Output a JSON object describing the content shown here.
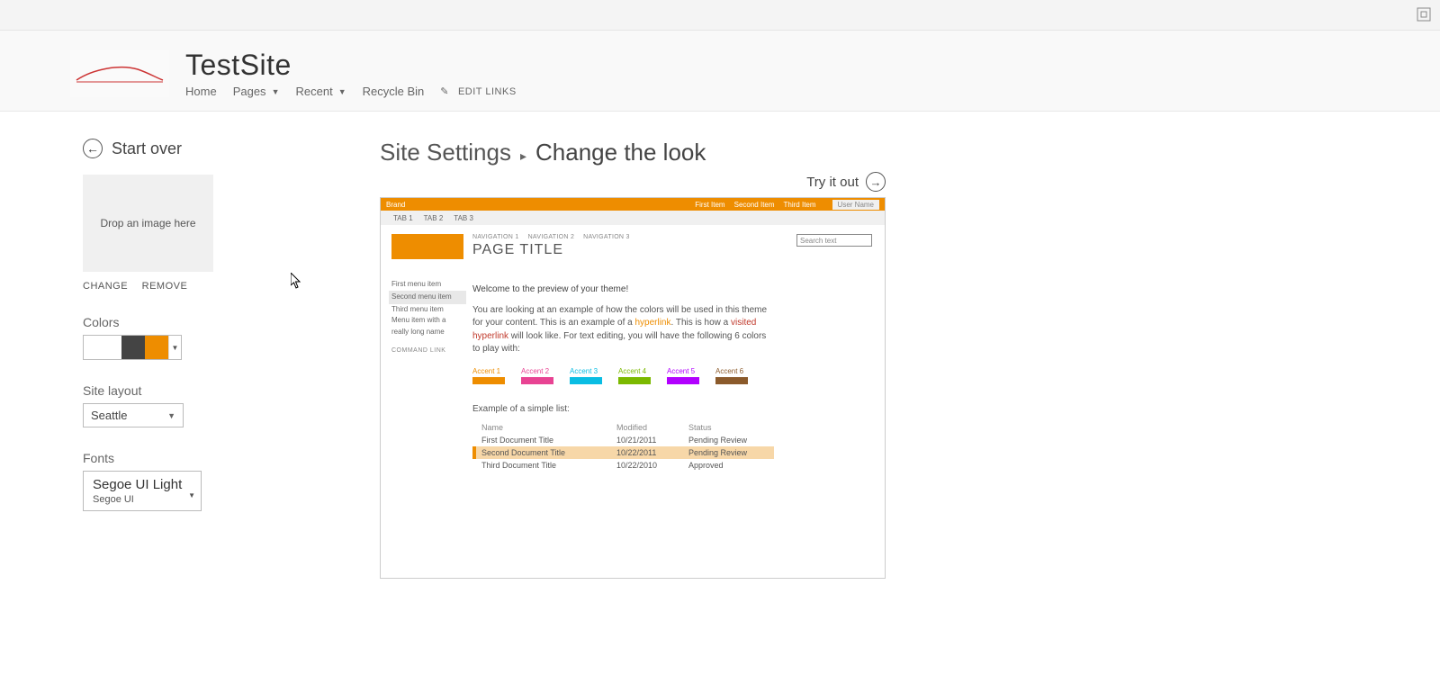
{
  "header": {
    "site_title": "TestSite",
    "nav": {
      "home": "Home",
      "pages": "Pages",
      "recent": "Recent",
      "recycle": "Recycle Bin",
      "edit_links": "EDIT LINKS"
    }
  },
  "sidebar": {
    "start_over": "Start over",
    "drop_hint": "Drop an image here",
    "change": "CHANGE",
    "remove": "REMOVE",
    "colors_label": "Colors",
    "layout_label": "Site layout",
    "layout_value": "Seattle",
    "fonts_label": "Fonts",
    "font_primary": "Segoe UI Light",
    "font_secondary": "Segoe UI"
  },
  "main": {
    "crumb1": "Site Settings",
    "crumb2": "Change the look",
    "tryout": "Try it out"
  },
  "preview": {
    "brand": "Brand",
    "topnav": [
      "First Item",
      "Second Item",
      "Third Item"
    ],
    "user": "User Name",
    "tabs": [
      "TAB 1",
      "TAB 2",
      "TAB 3"
    ],
    "nav_items": [
      "NAVIGATION 1",
      "NAVIGATION 2",
      "NAVIGATION 3"
    ],
    "page_title": "PAGE TITLE",
    "search_placeholder": "Search text",
    "menu": [
      "First menu item",
      "Second menu item",
      "Third menu item",
      "Menu item with a really long name"
    ],
    "command": "COMMAND LINK",
    "welcome": "Welcome to the preview of your theme!",
    "para1a": "You are looking at an example of how the colors will be used in this theme for your content. This is an example of a ",
    "hyperlink": "hyperlink",
    "para1b": ". This is how a ",
    "visited": "visited hyperlink",
    "para1c": " will look like. For text editing, you will have the following 6 colors to play with:",
    "accents": [
      "Accent 1",
      "Accent 2",
      "Accent 3",
      "Accent 4",
      "Accent 5",
      "Accent 6"
    ],
    "table_caption": "Example of a simple list:",
    "table_headers": {
      "name": "Name",
      "modified": "Modified",
      "status": "Status"
    },
    "table_rows": [
      {
        "name": "First Document Title",
        "modified": "10/21/2011",
        "status": "Pending Review"
      },
      {
        "name": "Second Document Title",
        "modified": "10/22/2011",
        "status": "Pending Review"
      },
      {
        "name": "Third Document Title",
        "modified": "10/22/2010",
        "status": "Approved"
      }
    ]
  }
}
